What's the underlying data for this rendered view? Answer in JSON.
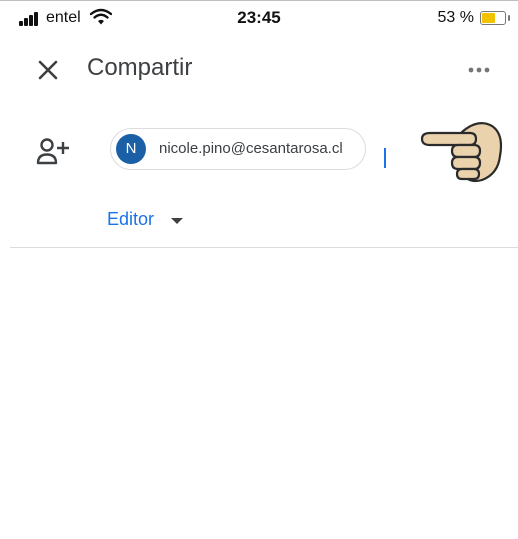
{
  "status_bar": {
    "carrier": "entel",
    "time": "23:45",
    "battery_percent": "53 %",
    "battery_level": 0.53,
    "battery_color": "#f2c200"
  },
  "header": {
    "title": "Compartir",
    "close_icon": "close-icon",
    "more_icon": "more-horizontal-icon"
  },
  "share": {
    "add_person_icon": "add-person-icon",
    "recipient": {
      "avatar_letter": "N",
      "avatar_color": "#1b5fa6",
      "email": "nicole.pino@cesantarosa.cl"
    },
    "pointer_icon": "pointing-hand-icon"
  },
  "role": {
    "label": "Editor",
    "label_color": "#1a73e8"
  }
}
